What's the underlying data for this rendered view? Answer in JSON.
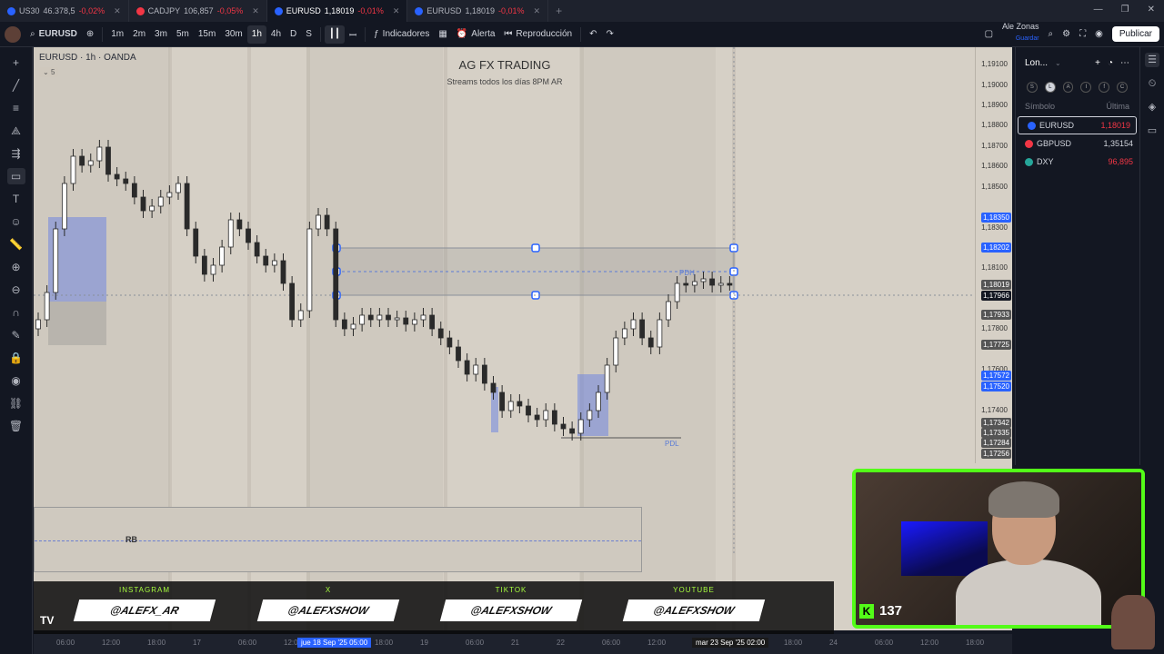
{
  "browser_tabs": [
    {
      "symbol": "US30",
      "price": "46.378,5",
      "change": "-0,02%",
      "extra": "Al",
      "color": "#2962ff",
      "active": false
    },
    {
      "symbol": "CADJPY",
      "price": "106,857",
      "change": "-0,05%",
      "extra": "",
      "color": "#f23645",
      "active": false
    },
    {
      "symbol": "EURUSD",
      "price": "1,18019",
      "change": "-0,01%",
      "extra": "",
      "color": "#2962ff",
      "active": true
    },
    {
      "symbol": "EURUSD",
      "price": "1,18019",
      "change": "-0,01%",
      "extra": "",
      "color": "#2962ff",
      "active": false
    }
  ],
  "toolbar": {
    "symbol": "EURUSD",
    "timeframes": [
      "1m",
      "2m",
      "3m",
      "5m",
      "15m",
      "30m",
      "1h",
      "4h",
      "D",
      "S"
    ],
    "selected_timeframe": "1h",
    "indicators": "Indicadores",
    "alert": "Alerta",
    "replay": "Reproducción",
    "user_name": "Ale Zonas",
    "user_sub": "Guardar",
    "publish": "Publicar"
  },
  "left_tools": [
    "cursor-icon",
    "trend-line-icon",
    "fib-icon",
    "pattern-icon",
    "forecast-icon",
    "rectangle-icon",
    "text-icon",
    "emoji-icon",
    "ruler-icon",
    "zoom-in-icon",
    "zoom-out-icon",
    "magnet-icon",
    "lock-drawing-icon",
    "lock-icon",
    "eye-icon",
    "link-icon",
    "trash-icon"
  ],
  "chart": {
    "symbol_title": "EURUSD · 1h · OANDA",
    "collapse_count": "5",
    "watermark_title": "AG FX TRADING",
    "watermark_sub": "Streams todos los días 8PM AR",
    "pdh_label": "PDH",
    "pdl_label": "PDL",
    "rb_label": "RB"
  },
  "price_axis": {
    "labels": [
      "1,19100",
      "1,19000",
      "1,18900",
      "1,18800",
      "1,18700",
      "1,18600",
      "1,18500",
      "1,18300",
      "1,18100",
      "1,17800",
      "1,17600",
      "1,17400"
    ],
    "badges": [
      {
        "text": "1,18350",
        "color": "#2962ff"
      },
      {
        "text": "1,18202",
        "color": "#2962ff"
      },
      {
        "text": "1,18019",
        "color": "#555555"
      },
      {
        "text": "1,17966",
        "color": "#131722"
      },
      {
        "text": "1,17933",
        "color": "#555555"
      },
      {
        "text": "1,17725",
        "color": "#555555"
      },
      {
        "text": "1,17572",
        "color": "#2962ff"
      },
      {
        "text": "1,17520",
        "color": "#2962ff"
      },
      {
        "text": "1,17342",
        "color": "#555555"
      },
      {
        "text": "1,17335",
        "color": "#555555"
      },
      {
        "text": "1,17284",
        "color": "#555555"
      },
      {
        "text": "1,17256",
        "color": "#555555"
      }
    ]
  },
  "time_axis": {
    "labels": [
      "06:00",
      "12:00",
      "18:00",
      "17",
      "06:00",
      "12:00",
      "18:00",
      "18:00",
      "19",
      "06:00",
      "21",
      "22",
      "06:00",
      "12:00",
      "18:00",
      "12:00",
      "18:00",
      "24",
      "06:00",
      "12:00",
      "18:00"
    ],
    "highlight_left": "jue 18 Sep '25  05:00",
    "highlight_right": "mar 23 Sep '25  02:00"
  },
  "social": [
    {
      "label": "INSTAGRAM",
      "handle": "@ALEFX_AR"
    },
    {
      "label": "X",
      "handle": "@ALEFXSHOW"
    },
    {
      "label": "TIKTOK",
      "handle": "@ALEFXSHOW"
    },
    {
      "label": "YOUTUBE",
      "handle": "@ALEFXSHOW"
    }
  ],
  "watchlist": {
    "title": "Lon...",
    "filters": [
      "S",
      "L",
      "A",
      "I",
      "f",
      "C"
    ],
    "col_symbol": "Símbolo",
    "col_last": "Última",
    "rows": [
      {
        "symbol": "EURUSD",
        "last": "1,18019",
        "trend": "down",
        "color": "#2962ff"
      },
      {
        "symbol": "GBPUSD",
        "last": "1,35154",
        "trend": "up",
        "color": "#f23645"
      },
      {
        "symbol": "DXY",
        "last": "96,895",
        "trend": "down",
        "color": "#26a69a"
      }
    ]
  },
  "stream": {
    "platform_icon": "kick-icon",
    "viewer_count": "137",
    "accent": "#53fc18"
  }
}
